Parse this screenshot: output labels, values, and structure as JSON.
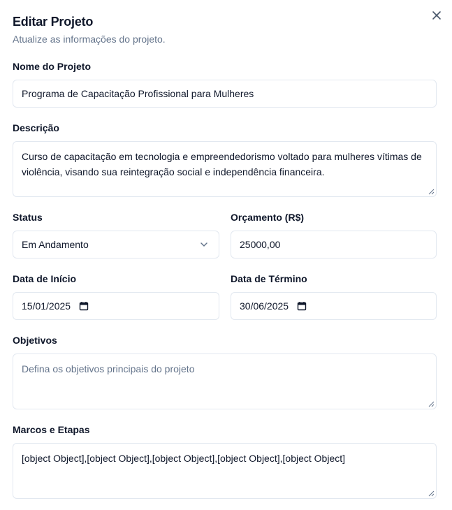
{
  "dialog": {
    "title": "Editar Projeto",
    "subtitle": "Atualize as informações do projeto."
  },
  "fields": {
    "name": {
      "label": "Nome do Projeto",
      "value": "Programa de Capacitação Profissional para Mulheres"
    },
    "description": {
      "label": "Descrição",
      "value": "Curso de capacitação em tecnologia e empreendedorismo voltado para mulheres vítimas de violência, visando sua reintegração social e independência financeira."
    },
    "status": {
      "label": "Status",
      "value": "Em Andamento"
    },
    "budget": {
      "label": "Orçamento (R$)",
      "value": "25000,00"
    },
    "start_date": {
      "label": "Data de Início",
      "value": "15/01/2025"
    },
    "end_date": {
      "label": "Data de Término",
      "value": "30/06/2025"
    },
    "objectives": {
      "label": "Objetivos",
      "placeholder": "Defina os objetivos principais do projeto",
      "value": ""
    },
    "milestones": {
      "label": "Marcos e Etapas",
      "value": "[object Object],[object Object],[object Object],[object Object],[object Object]"
    }
  },
  "icons": {
    "close": "close-icon",
    "chevron": "chevron-down-icon",
    "calendar": "calendar-icon"
  },
  "colors": {
    "text": "#0f172a",
    "muted": "#64748b",
    "border": "#e2e8f0"
  }
}
